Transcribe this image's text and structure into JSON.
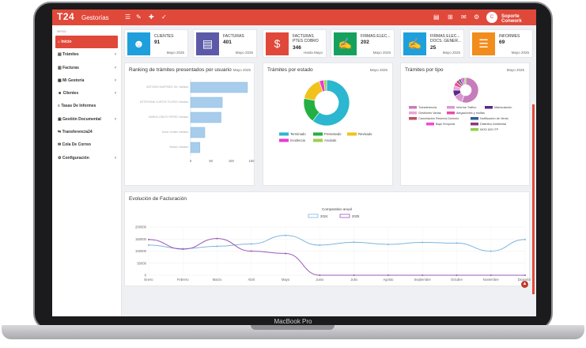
{
  "device": {
    "brand": "MacBook Pro"
  },
  "topbar": {
    "logo": "T24",
    "app_name": "Gestorías",
    "user_name": "Soporte Conwork",
    "avatar_initials": "C"
  },
  "sidebar": {
    "header": "MENÚ",
    "items": [
      {
        "label": "Inicio",
        "icon": "home-icon",
        "active": true,
        "chevron": false
      },
      {
        "label": "Trámites",
        "icon": "document-icon",
        "active": false,
        "chevron": true
      },
      {
        "label": "Facturas",
        "icon": "invoice-icon",
        "active": false,
        "chevron": true
      },
      {
        "label": "Mi Gestoría",
        "icon": "chart-icon",
        "active": false,
        "chevron": true
      },
      {
        "label": "Clientes",
        "icon": "users-icon",
        "active": false,
        "chevron": true
      },
      {
        "label": "Tasas De Informes",
        "icon": "list-icon",
        "active": false,
        "chevron": false
      },
      {
        "label": "Gestión Documental",
        "icon": "folder-icon",
        "active": false,
        "chevron": true
      },
      {
        "label": "Transferencia24",
        "icon": "transfer-icon",
        "active": false,
        "chevron": false
      },
      {
        "label": "Cola De Correo",
        "icon": "mail-icon",
        "active": false,
        "chevron": false
      },
      {
        "label": "Configuración",
        "icon": "gear-icon",
        "active": false,
        "chevron": true
      }
    ]
  },
  "stats": [
    {
      "label": "CLIENTES",
      "value": "91",
      "date": "Mayo 2025",
      "color": "#1f9fdc",
      "icon": "users-icon"
    },
    {
      "label": "FACTURAS",
      "value": "401",
      "date": "Mayo 2025",
      "color": "#5c5aa8",
      "icon": "document-icon"
    },
    {
      "label": "FACTURAS PTES COBRO",
      "value": "346",
      "date": "Hasta Mayo",
      "color": "#e0483a",
      "icon": "money-hand-icon"
    },
    {
      "label": "FIRMAS ELEC...",
      "value": "202",
      "date": "Mayo 2025",
      "color": "#16a05d",
      "icon": "signature-icon"
    },
    {
      "label": "FIRMAS ELEC... DOCS. GENER...",
      "value": "25",
      "date": "Mayo 2025",
      "color": "#1f9fdc",
      "icon": "signature-icon"
    },
    {
      "label": "INFORMES",
      "value": "69",
      "date": "Mayo 2025",
      "color": "#f28c1c",
      "icon": "report-icon"
    }
  ],
  "panels": {
    "ranking": {
      "title": "Ranking de trámites presentados por usuario",
      "date": "Mayo 2025"
    },
    "estado": {
      "title": "Trámites por estado",
      "date": "Mayo 2025"
    },
    "tipo": {
      "title": "Trámites por tipo",
      "date": "Mayo 2025"
    },
    "evolucion": {
      "title": "Evolución de Facturación"
    }
  },
  "chart_data": [
    {
      "type": "bar",
      "orientation": "horizontal",
      "categories": [
        "ANTONIO MARTINEZ GIL Vairlasa",
        "ESTEPHANI CUESTA TOLEDO Vairlasa",
        "MARIA LOBATO PEREZ Vairlasa",
        "Jesus Vivales Vairlasa",
        "Beatriz Vairlasa"
      ],
      "values": [
        140,
        78,
        75,
        35,
        23
      ],
      "xlim": [
        0,
        150
      ],
      "xticks": [
        0,
        50,
        100,
        150
      ],
      "color": "#a8cdec"
    },
    {
      "type": "pie",
      "donut": true,
      "labels": [
        "Terminado",
        "Presentado",
        "Revisado",
        "Incidencia",
        "Anulado"
      ],
      "values": [
        58,
        17,
        16,
        3,
        2
      ],
      "colors": [
        "#2ab7cf",
        "#23b043",
        "#f0c21b",
        "#e83bd2",
        "#9fcf4e"
      ],
      "legend": "bottom"
    },
    {
      "type": "pie",
      "donut": true,
      "labels": [
        "Transferencia",
        "Informe Tráfico",
        "Matriculación",
        "Gestiones Varias",
        "Alegaciones y multas",
        "Cancelación Reserva Dominio",
        "Notificación de Venta",
        "Baja Temporal",
        "Distintivo Ambiental",
        "MOD 620 ITP"
      ],
      "values": [
        55,
        12,
        8,
        6,
        5,
        4,
        3,
        3,
        2,
        2
      ],
      "colors": [
        "#c77dba",
        "#d99ad4",
        "#5b2a86",
        "#e8a6d8",
        "#e84ca7",
        "#c0505f",
        "#2d5f9a",
        "#f049d4",
        "#8a3d7a",
        "#8fd24c"
      ],
      "legend": "bottom"
    },
    {
      "type": "line",
      "title": "Comparativo anual",
      "categories": [
        "Enero",
        "Febrero",
        "Marzo",
        "Abril",
        "Mayo",
        "Junio",
        "Julio",
        "Agosto",
        "Septiembre",
        "Octubre",
        "Noviembre",
        "Diciembre"
      ],
      "series": [
        {
          "name": "2024",
          "values": [
            125000,
            110000,
            120000,
            130000,
            165000,
            125000,
            137000,
            128000,
            136000,
            133000,
            100000,
            148000
          ],
          "color": "#7fb5dd"
        },
        {
          "name": "2025",
          "values": [
            148000,
            108000,
            152000,
            100000,
            90000,
            0,
            0,
            0,
            0,
            0,
            0,
            0
          ],
          "color": "#9b59b6"
        }
      ],
      "ylim": [
        0,
        200000
      ],
      "yticks": [
        0,
        50000,
        100000,
        150000,
        200000
      ],
      "legend": "top"
    }
  ]
}
